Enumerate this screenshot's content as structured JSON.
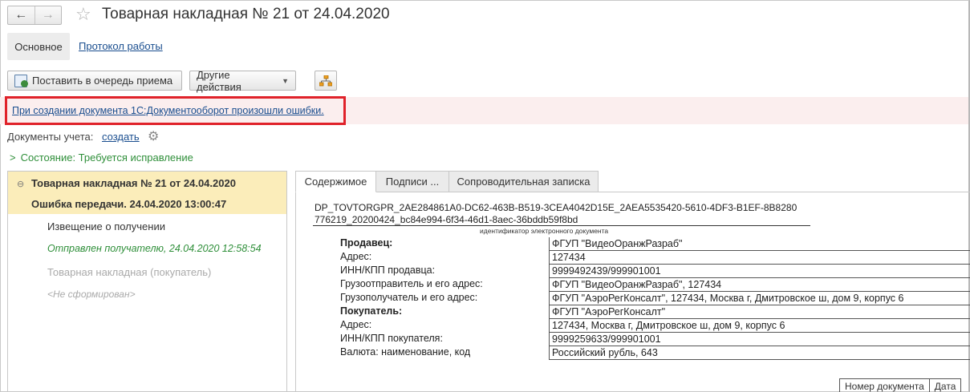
{
  "window": {
    "title": "Товарная накладная № 21 от 24.04.2020",
    "back_icon": "←",
    "forward_icon": "→",
    "star_icon": "☆"
  },
  "tabs": {
    "main": "Основное",
    "protocol": "Протокол работы"
  },
  "toolbar": {
    "queue_button": "Поставить в очередь приема",
    "other_actions": "Другие действия"
  },
  "error": {
    "message": "При создании документа 1С:Документооборот произошли ошибки.",
    "highlight_color": "#e0222a"
  },
  "documents": {
    "label": "Документы учета:",
    "create_link": "создать"
  },
  "state": {
    "text": "Состояние: Требуется исправление",
    "color": "#2f8f3a"
  },
  "tree": {
    "items": [
      "Товарная накладная № 21 от 24.04.2020",
      "Ошибка передачи. 24.04.2020 13:00:47",
      "Извещение о получении",
      "Отправлен получателю, 24.04.2020 12:58:54",
      "Товарная накладная (покупатель)",
      "<Не сформирован>"
    ]
  },
  "content_tabs": [
    "Содержимое",
    "Подписи ...",
    "Сопроводительная записка"
  ],
  "document": {
    "id_line1": "DP_TOVTORGPR_2AE284861A0-DC62-463B-B519-3CEA4042D15E_2AEA5535420-5610-4DF3-B1EF-8B8280",
    "id_line2": "776219_20200424_bc84e994-6f34-46d1-8aec-36bddb59f8bd",
    "id_caption": "идентификатор электронного документа",
    "fields": [
      {
        "label": "Продавец:",
        "value": "ФГУП \"ВидеоОранжРазраб\"",
        "bold": true
      },
      {
        "label": "Адрес:",
        "value": "127434",
        "bold": false
      },
      {
        "label": "ИНН/КПП продавца:",
        "value": "9999492439/999901001",
        "bold": false
      },
      {
        "label": "Грузоотправитель и его адрес:",
        "value": "ФГУП \"ВидеоОранжРазраб\", 127434",
        "bold": false
      },
      {
        "label": "Грузополучатель и его адрес:",
        "value": "ФГУП \"АэроРегКонсалт\", 127434, Москва г, Дмитровское ш, дом 9, корпус 6",
        "bold": false
      },
      {
        "label": "Покупатель:",
        "value": "ФГУП \"АэроРегКонсалт\"",
        "bold": true
      },
      {
        "label": "Адрес:",
        "value": "127434, Москва г, Дмитровское ш, дом 9, корпус 6",
        "bold": false
      },
      {
        "label": "ИНН/КПП покупателя:",
        "value": "9999259633/999901001",
        "bold": false
      },
      {
        "label": "Валюта: наименование, код",
        "value": "Российский рубль, 643",
        "bold": false
      }
    ],
    "table_headers": [
      "Номер документа",
      "Дата"
    ]
  }
}
